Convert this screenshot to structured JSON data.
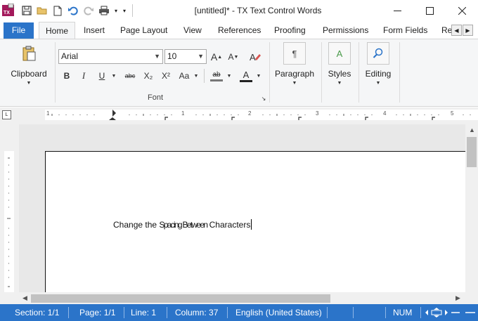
{
  "window": {
    "title": "[untitled]* - TX Text Control Words",
    "app_icon_text": "TX"
  },
  "tabs": [
    {
      "label": "File"
    },
    {
      "label": "Home"
    },
    {
      "label": "Insert"
    },
    {
      "label": "Page Layout"
    },
    {
      "label": "View"
    },
    {
      "label": "References"
    },
    {
      "label": "Proofing"
    },
    {
      "label": "Permissions"
    },
    {
      "label": "Form Fields"
    },
    {
      "label": "Re"
    }
  ],
  "ribbon": {
    "clipboard_label": "Clipboard",
    "font_name": "Arial",
    "font_size": "10",
    "font_group_label": "Font",
    "paragraph_label": "Paragraph",
    "styles_label": "Styles",
    "editing_label": "Editing",
    "bold_glyph": "B",
    "italic_glyph": "I",
    "underline_glyph": "U",
    "strike_glyph": "abc",
    "subscript_glyph": "X₂",
    "superscript_glyph": "X²",
    "case_glyph": "Aa",
    "grow_glyph": "A",
    "shrink_glyph": "A",
    "font_color_glyph": "A",
    "highlight_glyph": "ab",
    "paragraph_glyph": "¶",
    "styles_glyph": "A"
  },
  "ruler": {
    "corner_glyph": "L",
    "numbers": [
      "1",
      "1",
      "2",
      "3",
      "4",
      "5"
    ]
  },
  "document": {
    "text_before": "Change the ",
    "text_tight": "Spacing Between",
    "text_after": " Characters"
  },
  "status": {
    "section": "Section: 1/1",
    "page": "Page: 1/1",
    "line": "Line: 1",
    "column": "Column: 37",
    "language": "English (United States)",
    "num": "NUM"
  },
  "colors": {
    "accent": "#2b74c9",
    "ribbon_bg": "#f5f6f7"
  }
}
